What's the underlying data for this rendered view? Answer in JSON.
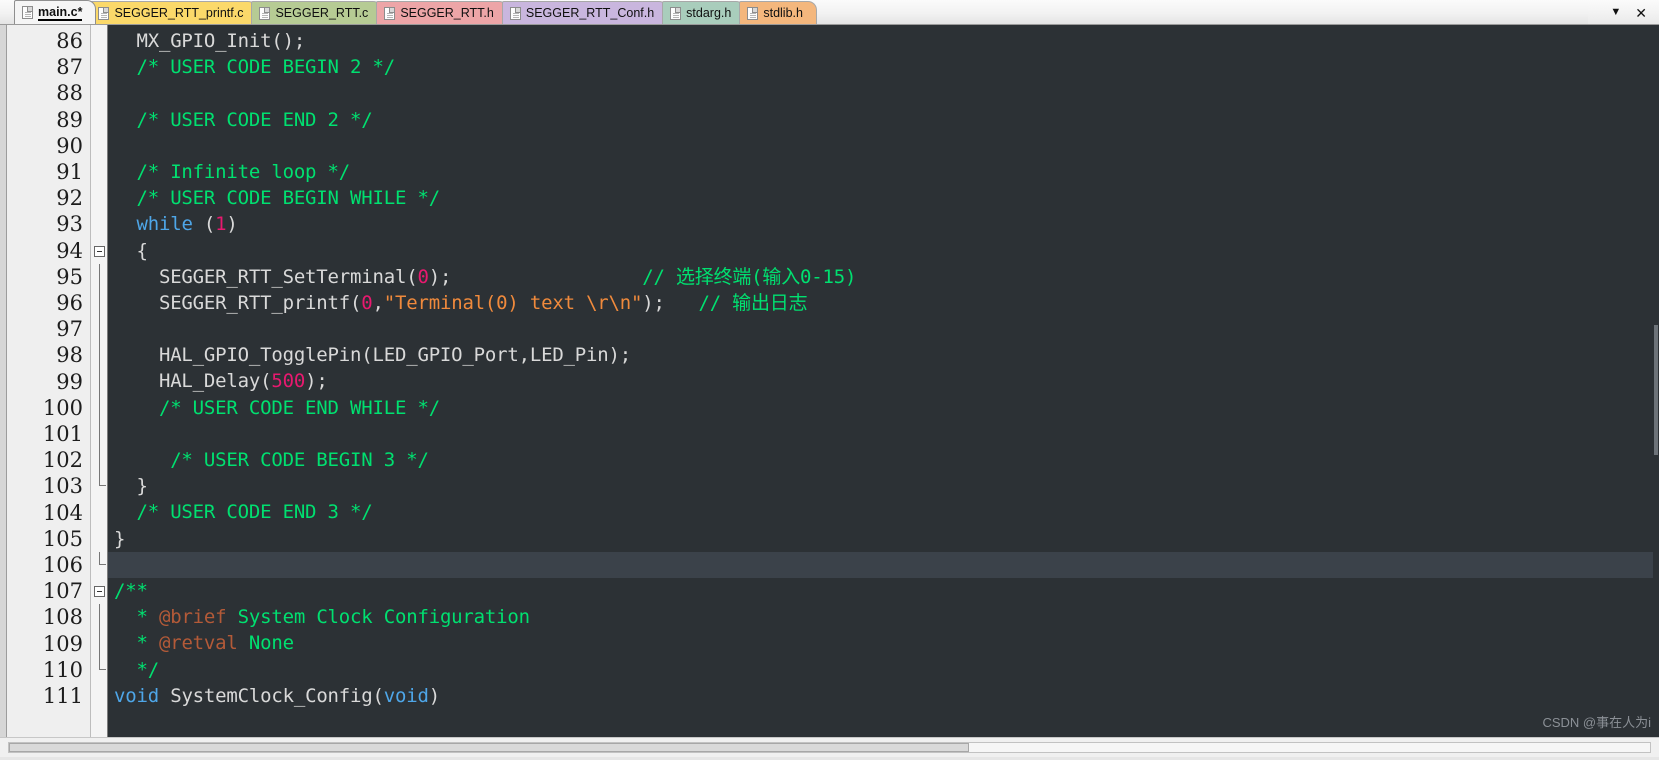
{
  "window": {
    "tab_overflow_label": "▼",
    "close_label": "✕"
  },
  "tabs": [
    {
      "label": "main.c*",
      "color_class": "tab-active",
      "active": true,
      "icon": "file-icon"
    },
    {
      "label": "SEGGER_RTT_printf.c",
      "color_class": "tab-yellow",
      "active": false,
      "icon": "file-icon"
    },
    {
      "label": "SEGGER_RTT.c",
      "color_class": "tab-green",
      "active": false,
      "icon": "file-icon"
    },
    {
      "label": "SEGGER_RTT.h",
      "color_class": "tab-red",
      "active": false,
      "icon": "file-icon"
    },
    {
      "label": "SEGGER_RTT_Conf.h",
      "color_class": "tab-purple",
      "active": false,
      "icon": "file-icon"
    },
    {
      "label": "stdarg.h",
      "color_class": "tab-teal",
      "active": false,
      "icon": "file-icon"
    },
    {
      "label": "stdlib.h",
      "color_class": "tab-orange",
      "active": false,
      "icon": "file-icon"
    }
  ],
  "editor": {
    "first_line": 86,
    "last_line": 111,
    "highlighted_line": 106,
    "line_numbers": [
      "86",
      "87",
      "88",
      "89",
      "90",
      "91",
      "92",
      "93",
      "94",
      "95",
      "96",
      "97",
      "98",
      "99",
      "100",
      "101",
      "102",
      "103",
      "104",
      "105",
      "106",
      "107",
      "108",
      "109",
      "110",
      "111"
    ],
    "lines": [
      {
        "n": "86",
        "text": "  MX_GPIO_Init();"
      },
      {
        "n": "87",
        "text": "  /* USER CODE BEGIN 2 */"
      },
      {
        "n": "88",
        "text": ""
      },
      {
        "n": "89",
        "text": "  /* USER CODE END 2 */"
      },
      {
        "n": "90",
        "text": ""
      },
      {
        "n": "91",
        "text": "  /* Infinite loop */"
      },
      {
        "n": "92",
        "text": "  /* USER CODE BEGIN WHILE */"
      },
      {
        "n": "93",
        "text": "  while (1)"
      },
      {
        "n": "94",
        "text": "  {"
      },
      {
        "n": "95",
        "text": "    SEGGER_RTT_SetTerminal(0);                 // 选择终端(输入0-15)"
      },
      {
        "n": "96",
        "text": "    SEGGER_RTT_printf(0,\"Terminal(0) text \\r\\n\");   // 输出日志"
      },
      {
        "n": "97",
        "text": ""
      },
      {
        "n": "98",
        "text": "    HAL_GPIO_TogglePin(LED_GPIO_Port,LED_Pin);"
      },
      {
        "n": "99",
        "text": "    HAL_Delay(500);"
      },
      {
        "n": "100",
        "text": "    /* USER CODE END WHILE */"
      },
      {
        "n": "101",
        "text": ""
      },
      {
        "n": "102",
        "text": "     /* USER CODE BEGIN 3 */"
      },
      {
        "n": "103",
        "text": "  }"
      },
      {
        "n": "104",
        "text": "  /* USER CODE END 3 */"
      },
      {
        "n": "105",
        "text": "}"
      },
      {
        "n": "106",
        "text": ""
      },
      {
        "n": "107",
        "text": "/**"
      },
      {
        "n": "108",
        "text": "  * @brief System Clock Configuration"
      },
      {
        "n": "109",
        "text": "  * @retval None"
      },
      {
        "n": "110",
        "text": "  */"
      },
      {
        "n": "111",
        "text": "void SystemClock_Config(void)"
      }
    ],
    "tokens": {
      "line86": [
        {
          "t": "  MX_GPIO_Init();",
          "c": "plain"
        }
      ],
      "line87": [
        {
          "t": "  /* USER CODE BEGIN 2 */",
          "c": "cmt"
        }
      ],
      "line88": [
        {
          "t": "",
          "c": "plain"
        }
      ],
      "line89": [
        {
          "t": "  /* USER CODE END 2 */",
          "c": "cmt"
        }
      ],
      "line90": [
        {
          "t": "",
          "c": "plain"
        }
      ],
      "line91": [
        {
          "t": "  /* Infinite loop */",
          "c": "cmt"
        }
      ],
      "line92": [
        {
          "t": "  /* USER CODE BEGIN WHILE */",
          "c": "cmt"
        }
      ],
      "line93": [
        {
          "t": "  ",
          "c": "plain"
        },
        {
          "t": "while",
          "c": "kw"
        },
        {
          "t": " (",
          "c": "plain"
        },
        {
          "t": "1",
          "c": "num"
        },
        {
          "t": ")",
          "c": "plain"
        }
      ],
      "line94": [
        {
          "t": "  {",
          "c": "plain"
        }
      ],
      "line95": [
        {
          "t": "    SEGGER_RTT_SetTerminal(",
          "c": "plain"
        },
        {
          "t": "0",
          "c": "num"
        },
        {
          "t": ");",
          "c": "plain"
        },
        {
          "t": "                 // 选择终端(输入0-15)",
          "c": "cmt"
        }
      ],
      "line96": [
        {
          "t": "    SEGGER_RTT_printf(",
          "c": "plain"
        },
        {
          "t": "0",
          "c": "num"
        },
        {
          "t": ",",
          "c": "plain"
        },
        {
          "t": "\"Terminal(0) text \\r\\n\"",
          "c": "str"
        },
        {
          "t": ");",
          "c": "plain"
        },
        {
          "t": "   // 输出日志",
          "c": "cmt"
        }
      ],
      "line97": [
        {
          "t": "",
          "c": "plain"
        }
      ],
      "line98": [
        {
          "t": "    HAL_GPIO_TogglePin(LED_GPIO_Port,LED_Pin);",
          "c": "plain"
        }
      ],
      "line99": [
        {
          "t": "    HAL_Delay(",
          "c": "plain"
        },
        {
          "t": "500",
          "c": "num"
        },
        {
          "t": ");",
          "c": "plain"
        }
      ],
      "line100": [
        {
          "t": "    /* USER CODE END WHILE */",
          "c": "cmt"
        }
      ],
      "line101": [
        {
          "t": "",
          "c": "plain"
        }
      ],
      "line102": [
        {
          "t": "     /* USER CODE BEGIN 3 */",
          "c": "cmt"
        }
      ],
      "line103": [
        {
          "t": "  }",
          "c": "plain"
        }
      ],
      "line104": [
        {
          "t": "  /* USER CODE END 3 */",
          "c": "cmt"
        }
      ],
      "line105": [
        {
          "t": "}",
          "c": "plain"
        }
      ],
      "line106": [
        {
          "t": "",
          "c": "plain"
        }
      ],
      "line107": [
        {
          "t": "/**",
          "c": "cmt"
        }
      ],
      "line108": [
        {
          "t": "  * ",
          "c": "cmt"
        },
        {
          "t": "@brief",
          "c": "doc"
        },
        {
          "t": " System Clock Configuration",
          "c": "cmt"
        }
      ],
      "line109": [
        {
          "t": "  * ",
          "c": "cmt"
        },
        {
          "t": "@retval",
          "c": "doc"
        },
        {
          "t": " None",
          "c": "cmt"
        }
      ],
      "line110": [
        {
          "t": "  */",
          "c": "cmt"
        }
      ],
      "line111": [
        {
          "t": "void",
          "c": "kw"
        },
        {
          "t": " SystemClock_Config(",
          "c": "plain"
        },
        {
          "t": "void",
          "c": "kw"
        },
        {
          "t": ")",
          "c": "plain"
        }
      ]
    }
  },
  "watermark": {
    "text": "CSDN @事在人为i"
  },
  "colors": {
    "editor_bg": "#2c3135",
    "highlight_line_bg": "#3b424a",
    "comment": "#00e070",
    "keyword": "#4ea6e8",
    "number": "#e8196f",
    "string": "#f08a3c",
    "doc_tag": "#b35a38",
    "plain_text": "#d9d9d9",
    "gutter_bg": "#efefef",
    "gutter_text": "#1d1d1d"
  }
}
